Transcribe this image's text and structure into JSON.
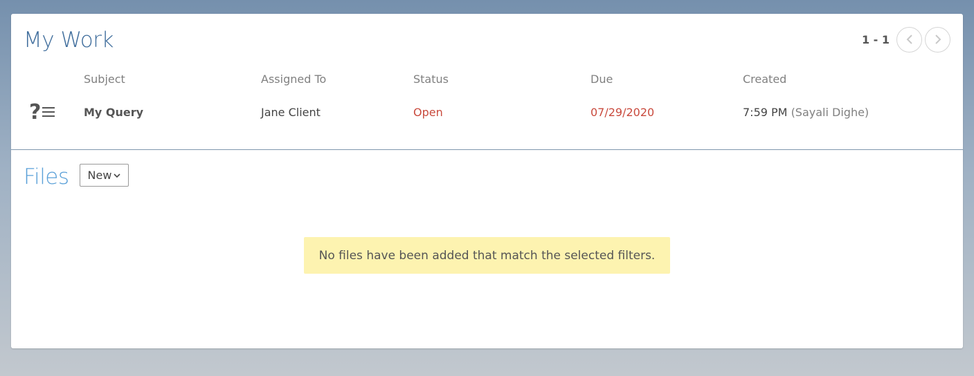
{
  "work": {
    "title": "My Work",
    "pager": {
      "range": "1 - 1",
      "prev_icon": "chevron-left-icon",
      "next_icon": "chevron-right-icon"
    },
    "columns": {
      "subject": "Subject",
      "assigned_to": "Assigned To",
      "status": "Status",
      "due": "Due",
      "created": "Created"
    },
    "rows": [
      {
        "icon": "query-list-icon",
        "subject": "My Query",
        "assigned_to": "Jane Client",
        "status": "Open",
        "due": "07/29/2020",
        "created_time": "7:59 PM",
        "created_by": "(Sayali Dighe)"
      }
    ]
  },
  "files": {
    "title": "Files",
    "new_label": "New",
    "empty_message": "No files have been added that match the selected filters."
  },
  "colors": {
    "title_blue": "#3f6d9c",
    "files_blue": "#5aa0d8",
    "status_red": "#c94a3d",
    "empty_bg": "#fdf3b0"
  }
}
